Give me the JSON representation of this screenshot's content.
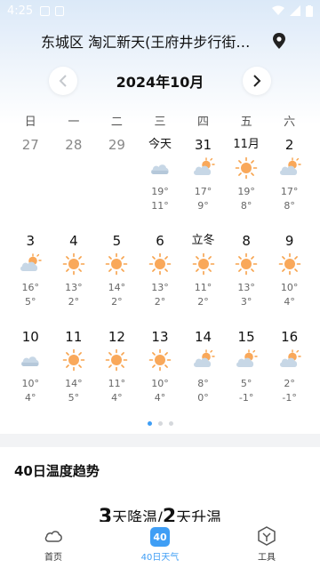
{
  "status_bar": {
    "time": "4:25"
  },
  "location": {
    "text": "东城区 淘汇新天(王府井步行街…"
  },
  "calendar": {
    "month_title": "2024年10月",
    "weekdays": [
      "日",
      "一",
      "二",
      "三",
      "四",
      "五",
      "六"
    ],
    "weeks": [
      [
        {
          "label": "27",
          "past": true
        },
        {
          "label": "28",
          "past": true
        },
        {
          "label": "29",
          "past": true
        },
        {
          "label": "今天",
          "icon": "cloudy-icon",
          "hi": "19°",
          "lo": "11°"
        },
        {
          "label": "31",
          "icon": "partly-cloudy-icon",
          "hi": "17°",
          "lo": "9°"
        },
        {
          "label": "11月",
          "icon": "sunny-icon",
          "hi": "19°",
          "lo": "8°"
        },
        {
          "label": "2",
          "icon": "partly-cloudy-icon",
          "hi": "17°",
          "lo": "8°"
        }
      ],
      [
        {
          "label": "3",
          "icon": "partly-cloudy-icon",
          "hi": "16°",
          "lo": "5°"
        },
        {
          "label": "4",
          "icon": "sunny-icon",
          "hi": "13°",
          "lo": "2°"
        },
        {
          "label": "5",
          "icon": "sunny-icon",
          "hi": "14°",
          "lo": "2°"
        },
        {
          "label": "6",
          "icon": "sunny-icon",
          "hi": "13°",
          "lo": "2°"
        },
        {
          "label": "立冬",
          "icon": "sunny-icon",
          "hi": "11°",
          "lo": "2°"
        },
        {
          "label": "8",
          "icon": "sunny-icon",
          "hi": "13°",
          "lo": "3°"
        },
        {
          "label": "9",
          "icon": "sunny-icon",
          "hi": "10°",
          "lo": "4°"
        }
      ],
      [
        {
          "label": "10",
          "icon": "cloudy-icon",
          "hi": "10°",
          "lo": "4°"
        },
        {
          "label": "11",
          "icon": "sunny-icon",
          "hi": "14°",
          "lo": "5°"
        },
        {
          "label": "12",
          "icon": "sunny-icon",
          "hi": "11°",
          "lo": "4°"
        },
        {
          "label": "13",
          "icon": "sunny-icon",
          "hi": "10°",
          "lo": "4°"
        },
        {
          "label": "14",
          "icon": "partly-cloudy-icon",
          "hi": "8°",
          "lo": "0°"
        },
        {
          "label": "15",
          "icon": "partly-cloudy-icon",
          "hi": "5°",
          "lo": "-1°"
        },
        {
          "label": "16",
          "icon": "partly-cloudy-icon",
          "hi": "2°",
          "lo": "-1°"
        }
      ]
    ]
  },
  "trend": {
    "title": "40日温度趋势",
    "down_days": "3",
    "down_text": "天降温/",
    "up_days": "2",
    "up_text": "天升温"
  },
  "tabs": [
    {
      "label": "首页",
      "icon": "cloud-outline-icon"
    },
    {
      "label": "40日天气",
      "icon": "badge-40-icon",
      "badge": "40",
      "active": true
    },
    {
      "label": "工具",
      "icon": "tool-icon"
    }
  ],
  "colors": {
    "accent": "#3f9ef5",
    "sun": "#f7a24b",
    "cloud": "#b9cde0"
  }
}
